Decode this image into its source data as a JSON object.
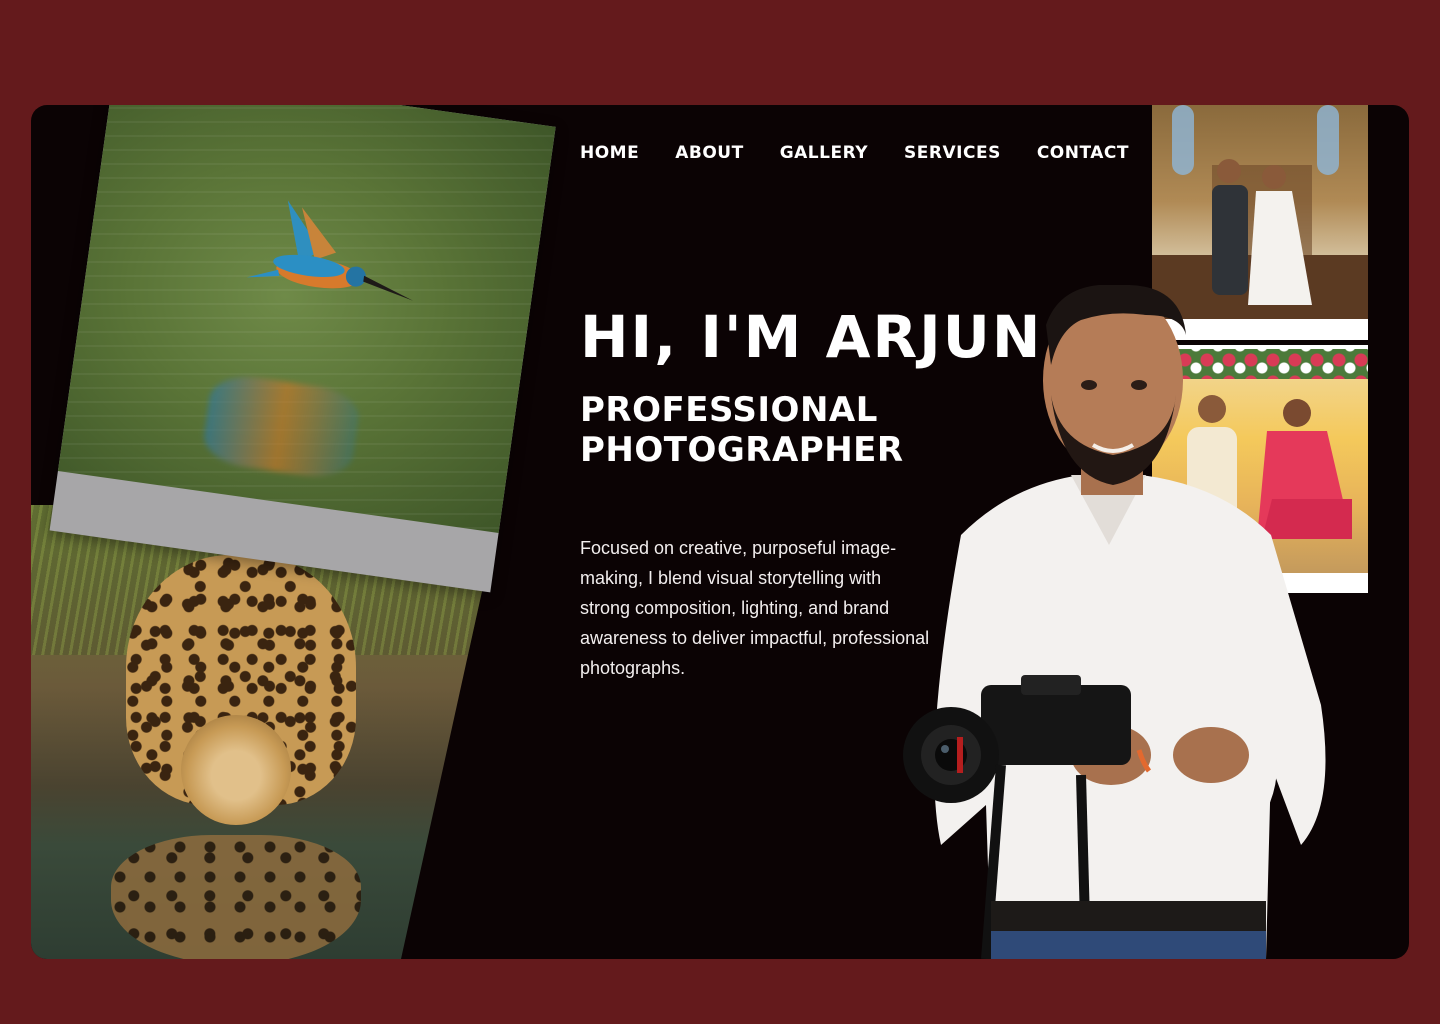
{
  "nav": {
    "items": [
      "HOME",
      "ABOUT",
      "GALLERY",
      "SERVICES",
      "CONTACT"
    ]
  },
  "hero": {
    "title": "HI, I'M ARJUN",
    "subtitle_line1": "PROFESSIONAL",
    "subtitle_line2": "PHOTOGRAPHER",
    "description": "Focused on creative, purposeful image-making, I blend visual storytelling with strong composition, lighting, and brand awareness to deliver impactful, professional photographs."
  },
  "colors": {
    "page_background": "#641a1c",
    "card_background": "#0b0304",
    "text": "#ffffff"
  }
}
